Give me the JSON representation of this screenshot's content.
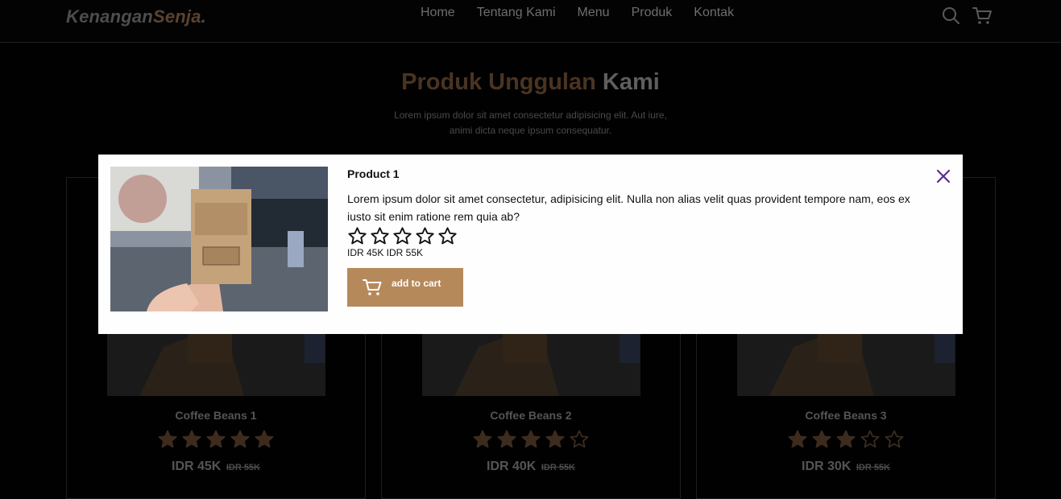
{
  "brand": {
    "part1": "Kenangan",
    "part2": "Senja",
    "dot": "."
  },
  "nav": {
    "links": [
      "Home",
      "Tentang Kami",
      "Menu",
      "Produk",
      "Kontak"
    ],
    "icons": [
      "search-icon",
      "shopping-cart-icon"
    ]
  },
  "section": {
    "title_part1": "Produk Unggulan",
    "title_part2": "Kami",
    "description": "Lorem ipsum dolor sit amet consectetur adipisicing elit. Aut iure, animi dicta neque ipsum consequatur."
  },
  "products": [
    {
      "name": "Coffee Beans 1",
      "rating": 5,
      "price": "IDR 45K",
      "old_price": "IDR 55K"
    },
    {
      "name": "Coffee Beans 2",
      "rating": 4,
      "price": "IDR 40K",
      "old_price": "IDR 55K"
    },
    {
      "name": "Coffee Beans 3",
      "rating": 3,
      "price": "IDR 30K",
      "old_price": "IDR 55K"
    }
  ],
  "modal": {
    "title": "Product 1",
    "description": "Lorem ipsum dolor sit amet consectetur, adipisicing elit. Nulla non alias velit quas provident tempore nam, eos ex iusto sit enim ratione rem quia ab?",
    "rating": 0,
    "star_count": 5,
    "price": "IDR 45K IDR 55K",
    "button_label": "add to cart"
  },
  "colors": {
    "accent": "#b6895b",
    "close_icon": "#5b2a91",
    "star_dim": "#3d2c1e"
  }
}
